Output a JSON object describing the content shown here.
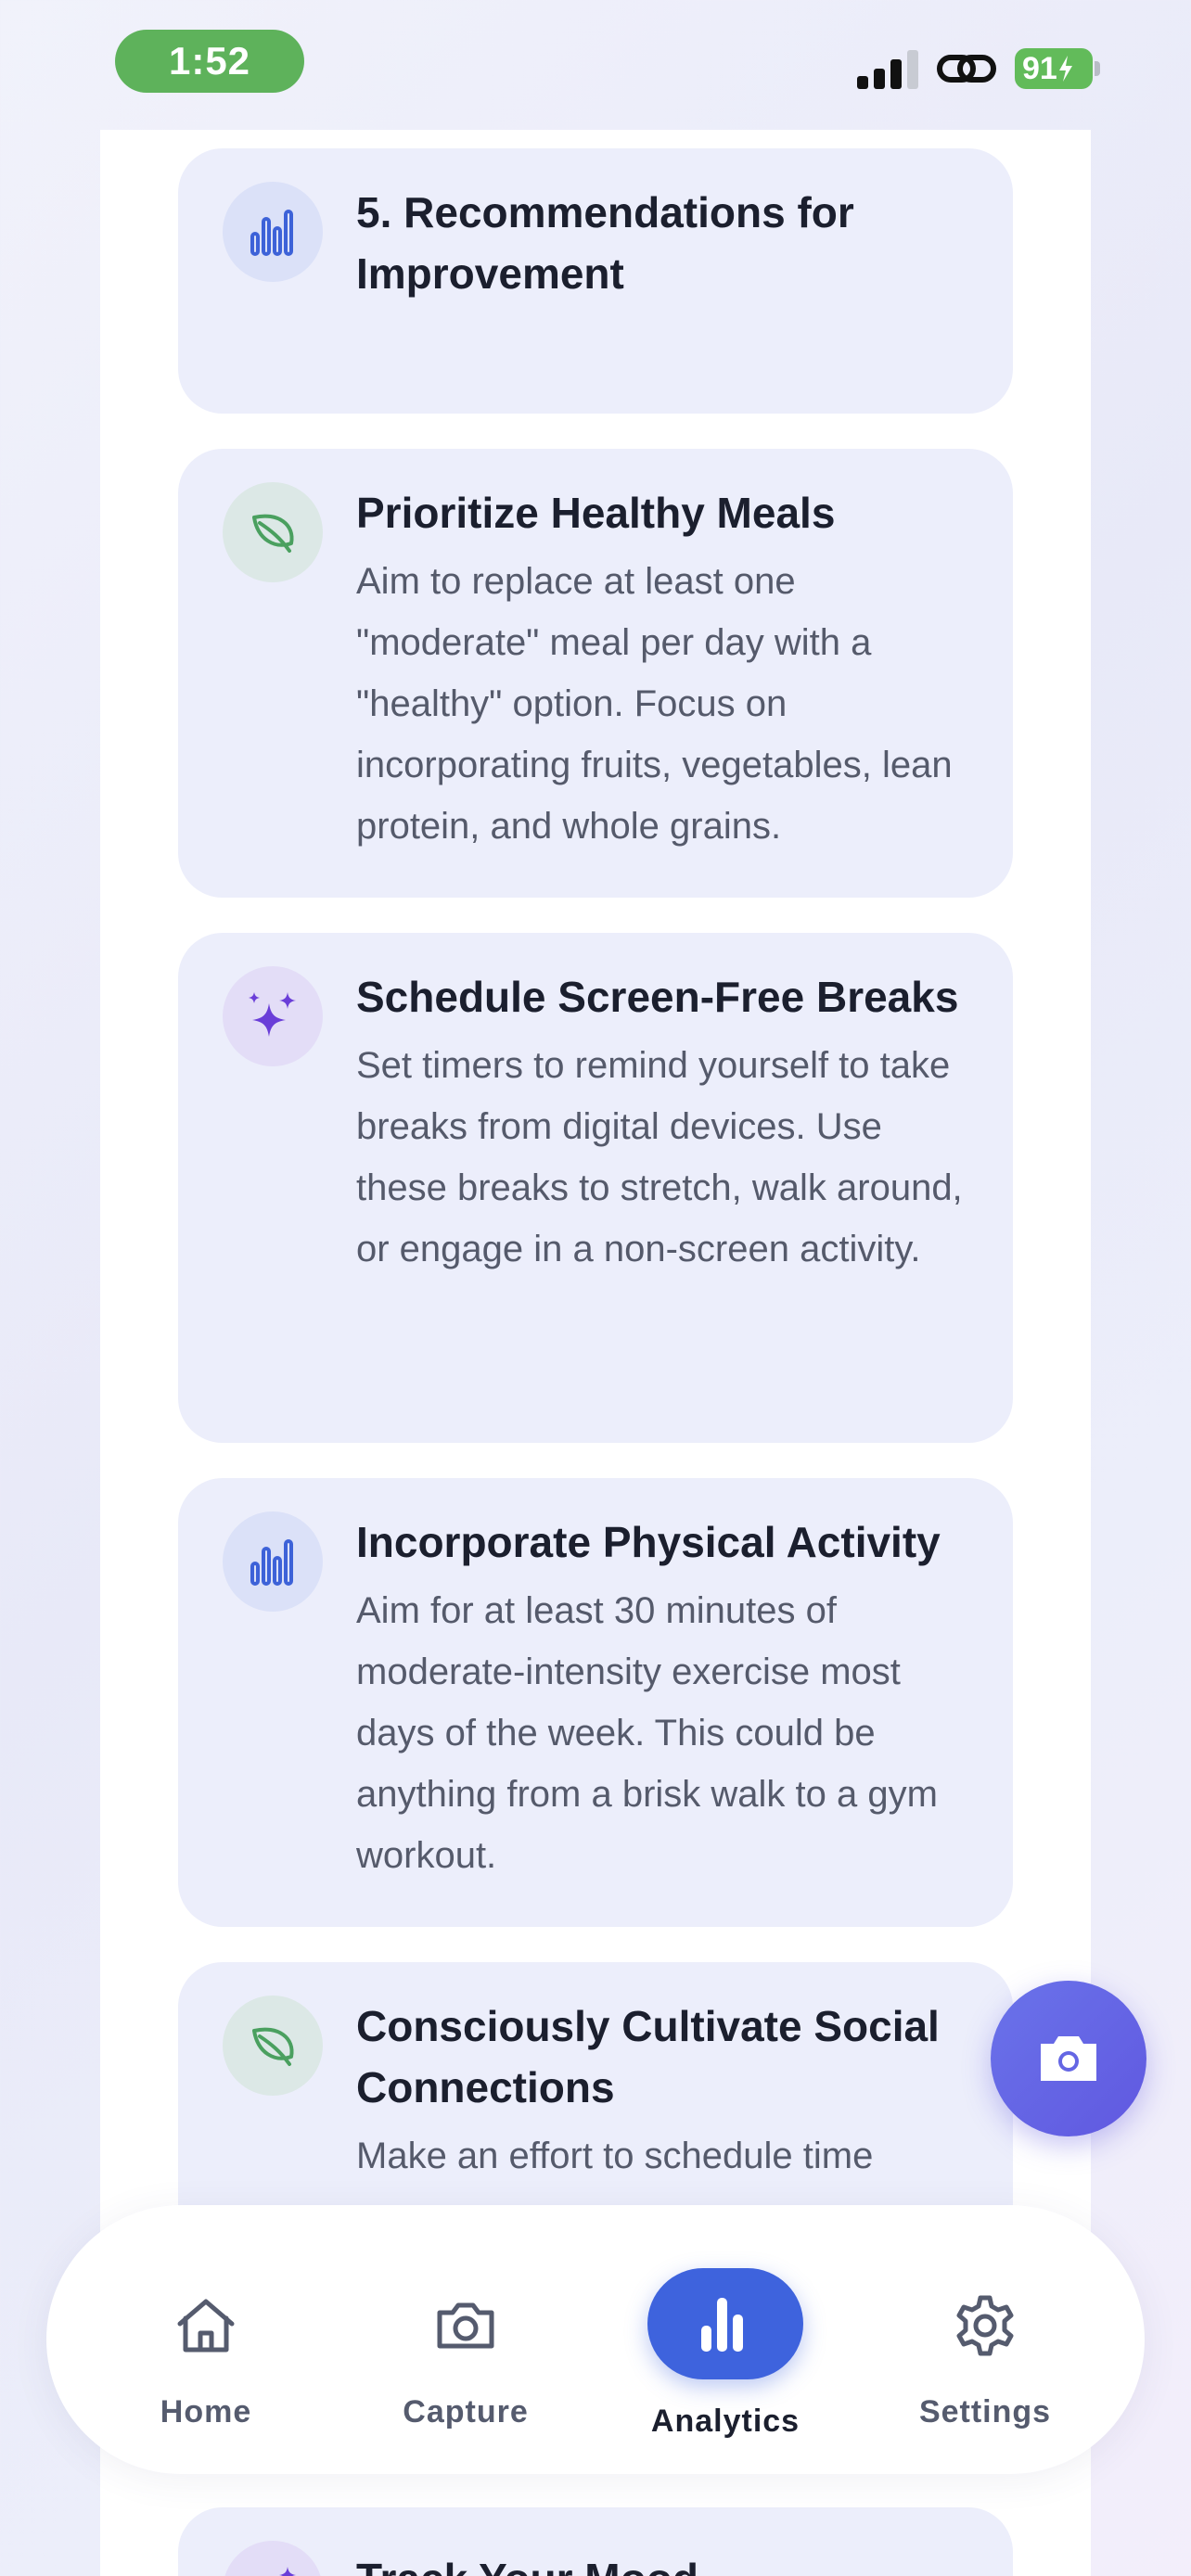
{
  "status_bar": {
    "time": "1:52",
    "battery": "91"
  },
  "cards": [
    {
      "icon": "bar-chart-icon",
      "title": "5. Recommendations for Improvement",
      "body": ""
    },
    {
      "icon": "leaf-icon",
      "title": "Prioritize Healthy Meals",
      "body": "Aim to replace at least one \"moderate\" meal per day with a \"healthy\" option. Focus on incorporating fruits, vegetables, lean protein, and whole grains."
    },
    {
      "icon": "sparkles-icon",
      "title": "Schedule Screen-Free Breaks",
      "body": "Set timers to remind yourself to take breaks from digital devices. Use these breaks to stretch, walk around, or engage in a non-screen activity."
    },
    {
      "icon": "bar-chart-icon",
      "title": "Incorporate Physical Activity",
      "body": "Aim for at least 30 minutes of moderate-intensity exercise most days of the week. This could be anything from a brisk walk to a gym workout."
    },
    {
      "icon": "leaf-icon",
      "title": "Consciously Cultivate Social Connections",
      "body": "Make an effort to schedule time"
    },
    {
      "icon": "sparkles-icon",
      "title": "Track Your Mood",
      "body": ""
    }
  ],
  "fab": {
    "icon": "camera-icon"
  },
  "tab_bar": {
    "tabs": [
      {
        "label": "Home",
        "icon": "home-icon"
      },
      {
        "label": "Capture",
        "icon": "camera-icon"
      },
      {
        "label": "Analytics",
        "icon": "analytics-icon",
        "active": true
      },
      {
        "label": "Settings",
        "icon": "gear-icon"
      }
    ]
  },
  "colors": {
    "accent": "#3e63dd",
    "fab": "#6058e0",
    "card_bg": "#eceefb",
    "time_pill": "#5eb25b"
  }
}
